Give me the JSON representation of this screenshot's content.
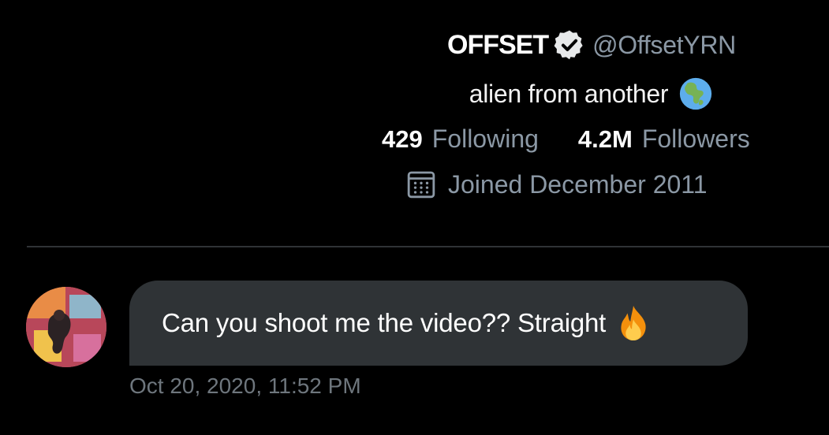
{
  "profile": {
    "display_name": "OFFSET",
    "handle": "@OffsetYRN",
    "bio": "alien from another",
    "bio_emoji": "globe-americas-icon",
    "following_count": "429",
    "following_label": "Following",
    "followers_count": "4.2M",
    "followers_label": "Followers",
    "joined": "Joined December 2011",
    "verified": true
  },
  "message": {
    "text": "Can you shoot me the video?? Straight",
    "emoji": "fire-icon",
    "timestamp": "Oct 20, 2020, 11:52 PM"
  },
  "colors": {
    "background": "#000000",
    "bubble": "#2f3336",
    "muted_text": "#8b98a5",
    "primary_text": "#ffffff",
    "divider": "#2f3336"
  }
}
